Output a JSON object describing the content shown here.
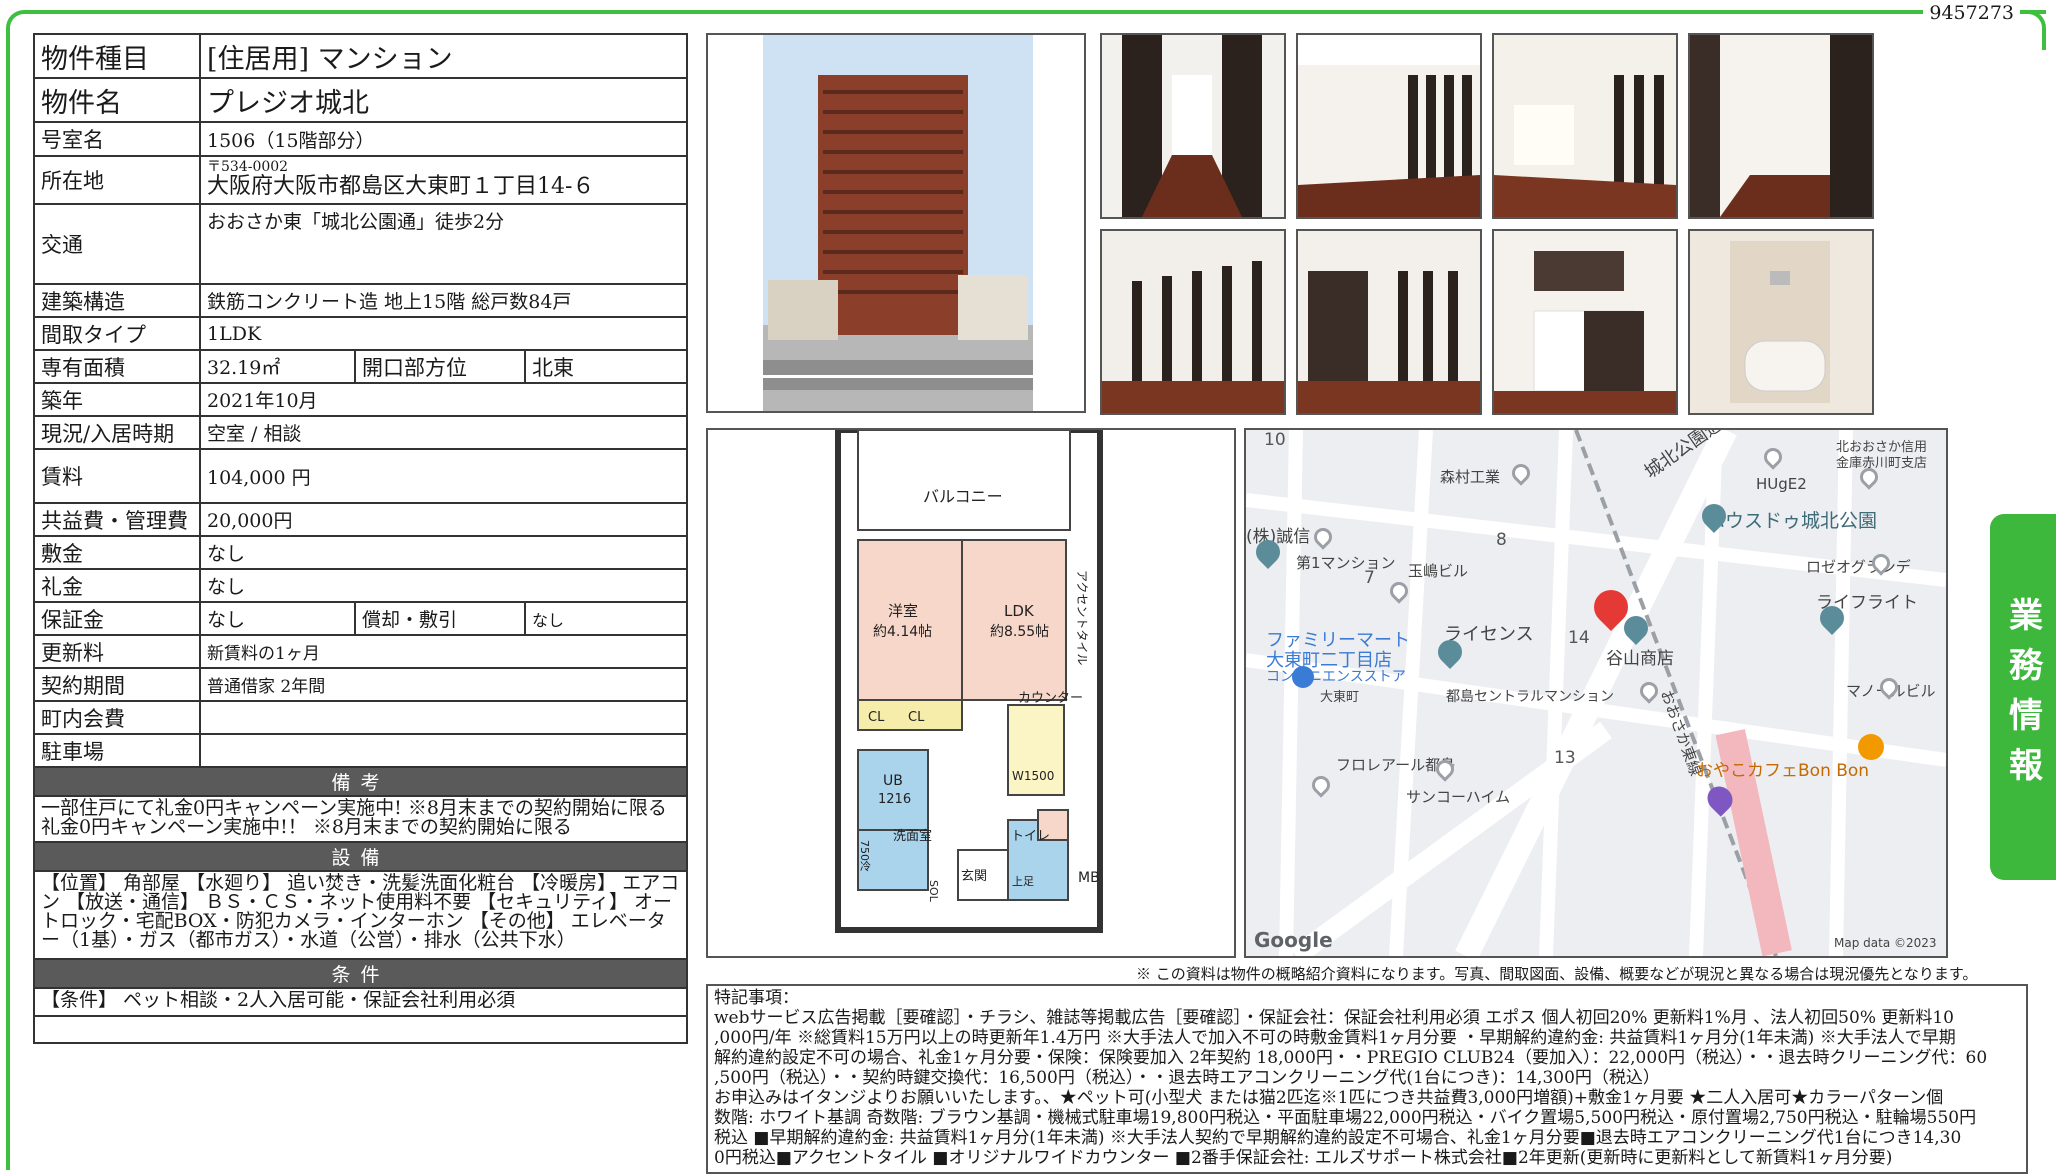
{
  "doc_id": "9457273",
  "property": {
    "rows": {
      "type_label": "物件種目",
      "type_value": "[住居用]  マンション",
      "name_label": "物件名",
      "name_value": "プレジオ城北",
      "room_label": "号室名",
      "room_value": "1506（15階部分）",
      "address_label": "所在地",
      "address_zip": "〒534-0002",
      "address_value": "大阪府大阪市都島区大東町１丁目14-６",
      "access_label": "交通",
      "access_value": "おおさか東「城北公園通」徒歩2分",
      "structure_label": "建築構造",
      "structure_value": "鉄筋コンクリート造 地上15階 総戸数84戸",
      "layout_label": "間取タイプ",
      "layout_value": "1LDK",
      "area_label": "専有面積",
      "area_value": "32.19㎡",
      "direction_label": "開口部方位",
      "direction_value": "北東",
      "built_label": "築年",
      "built_value": "2021年10月",
      "status_label": "現況/入居時期",
      "status_value": "空室 /  相談",
      "rent_label": "賃料",
      "rent_value": "104,000 円",
      "fee_label": "共益費・管理費",
      "fee_value": "20,000円",
      "deposit_label": "敷金",
      "deposit_value": "なし",
      "key_money_label": "礼金",
      "key_money_value": "なし",
      "guarantee_label": "保証金",
      "guarantee_value": "なし",
      "amort_label": "償却・敷引",
      "amort_value": "なし",
      "renewal_label": "更新料",
      "renewal_value": "新賃料の1ヶ月",
      "contract_label": "契約期間",
      "contract_value": "普通借家  2年間",
      "town_fee_label": "町内会費",
      "town_fee_value": "",
      "parking_label": "駐車場",
      "parking_value": ""
    },
    "sections": {
      "notes_title": "備考",
      "notes_line1": "一部住戸にて礼金0円キャンペーン実施中! ※8月末までの契約開始に限る",
      "notes_line2": "礼金0円キャンペーン実施中!！  ※8月末までの契約開始に限る",
      "facilities_title": "設備",
      "facilities_text": "【位置】 角部屋 【水廻り】 追い焚き・洗髪洗面化粧台 【冷暖房】 エアコン 【放送・通信】 ＢＳ・ＣＳ・ネット使用料不要 【セキュリティ】 オートロック・宅配BOX・防犯カメラ・インターホン 【その他】 エレベーター（1基）・ガス（都市ガス）・水道（公営）・排水（公共下水）",
      "conditions_title": "条件",
      "conditions_text": "【条件】 ペット相談・2人入居可能・保証会社利用必須"
    }
  },
  "floorplan": {
    "balcony": "バルコニー",
    "western_room": "洋室",
    "western_size": "約4.14帖",
    "ldk": "LDK",
    "ldk_size": "約8.55帖",
    "accent_tile": "アクセントタイル",
    "counter": "カウンター",
    "cl1": "CL",
    "cl2": "CL",
    "ub": "UB",
    "ub_size": "1216",
    "w1500": "W1500",
    "washroom": "洗面室",
    "toilet": "トイレ",
    "entrance": "玄関",
    "shoe": "上足",
    "mb": "MB",
    "rei": "冷",
    "sol": "SOL",
    "w750": "750"
  },
  "map": {
    "labels": {
      "moritsu": "森村工業",
      "jouhoku_dori": "城北公園通",
      "shinkin": "北おおさか信用",
      "shinkin2": "金庫赤川町支店",
      "huge": "HUgE2",
      "housedo": "ハウスドゥ城北公園",
      "seishin": "(株)誠信",
      "dai1": "第1マンション",
      "tamashima": "玉嶋ビル",
      "rozeo": "ロゼオグランデ",
      "lifelight": "ライフライト",
      "familymart1": "ファミリーマート",
      "familymart2": "大東町二丁目店",
      "familymart3": "コンビニエンスストア",
      "license": "ライセンス",
      "taniyama": "谷山商店",
      "osakahigashi": "おおさか東線",
      "daitocho": "大東町",
      "miyakojima": "都島セントラルマンション",
      "manor": "マノールビル",
      "floreal": "フロレアール都島",
      "sanko": "サンコーハイム",
      "cafe": "おやこカフェBon Bon",
      "google": "Google",
      "mapdata": "Map data ©2023",
      "n10": "10",
      "n8": "8",
      "n7": "7",
      "n14": "14",
      "n13": "13"
    }
  },
  "disclaimer": "※ この資料は物件の概略紹介資料になります。写真、間取図面、設備、概要などが現況と異なる場合は現況優先となります。",
  "remarks": {
    "title": "特記事項：",
    "line1": "webサービス広告掲載［要確認］・チラシ、雑誌等掲載広告［要確認］・保証会社：保証会社利用必須 エポス 個人初回20% 更新料1%月 、法人初回50% 更新料10",
    "line2": ",000円/年 ※総賃料15万円以上の時更新年1.4万円 ※大手法人で加入不可の時敷金賃料1ヶ月分要 ・早期解約違約金: 共益賃料1ヶ月分(1年未満) ※大手法人で早期",
    "line3": "解約違約設定不可の場合、礼金1ヶ月分要・保険：保険要加入 2年契約 18,000円・・PREGIO CLUB24（要加入）：22,000円（税込）・・退去時クリーニング代：60",
    "line4": ",500円（税込）・・契約時鍵交換代：16,500円（税込）・・退去時エアコンクリーニング代(1台につき)：14,300円（税込）",
    "line5": "お申込みはイタンジよりお願いいたします。、★ペット可(小型犬 または猫2匹迄※1匹につき共益費3,000円増額)+敷金1ヶ月要 ★二人入居可★カラーパターン個",
    "line6": "数階: ホワイト基調 奇数階: ブラウン基調・機械式駐車場19,800円税込・平面駐車場22,000円税込・バイク置場5,500円税込・原付置場2,750円税込・駐輪場550円",
    "line7": "税込 ■早期解約違約金: 共益賃料1ヶ月分(1年未満) ※大手法人契約で早期解約違約設定不可場合、礼金1ヶ月分要■退去時エアコンクリーニング代1台につき14,30",
    "line8": "0円税込■アクセントタイル ■オリジナルワイドカウンター ■2番手保証会社: エルズサポート株式会社■2年更新(更新時に更新料として新賃料1ヶ月分要)"
  },
  "side_tab": "業務情報",
  "colors": {
    "green": "#3db83d",
    "section_bg": "#5a5a5a",
    "pin_red": "#e53935"
  }
}
